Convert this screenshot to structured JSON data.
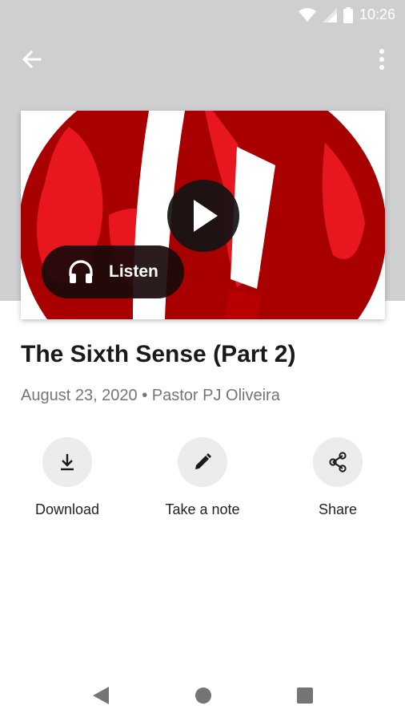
{
  "status_bar": {
    "time": "10:26",
    "icons": [
      "wifi-icon",
      "signal-icon",
      "battery-icon"
    ]
  },
  "app_bar": {
    "back_icon": "arrow-back-icon",
    "more_icon": "more-vert-icon"
  },
  "hero": {
    "play_icon": "play-icon",
    "listen_label": "Listen",
    "listen_icon": "headphones-icon",
    "colors": {
      "dark_red": "#a80000",
      "bright_red": "#e8161e"
    }
  },
  "sermon": {
    "title": "The Sixth Sense (Part 2)",
    "meta": "August 23, 2020 • Pastor PJ Oliveira"
  },
  "actions": [
    {
      "label": "Download",
      "icon": "download-icon"
    },
    {
      "label": "Take a note",
      "icon": "pencil-icon"
    },
    {
      "label": "Share",
      "icon": "share-icon"
    }
  ],
  "nav_bar": {
    "buttons": [
      "nav-back-icon",
      "nav-home-icon",
      "nav-recents-icon"
    ]
  }
}
